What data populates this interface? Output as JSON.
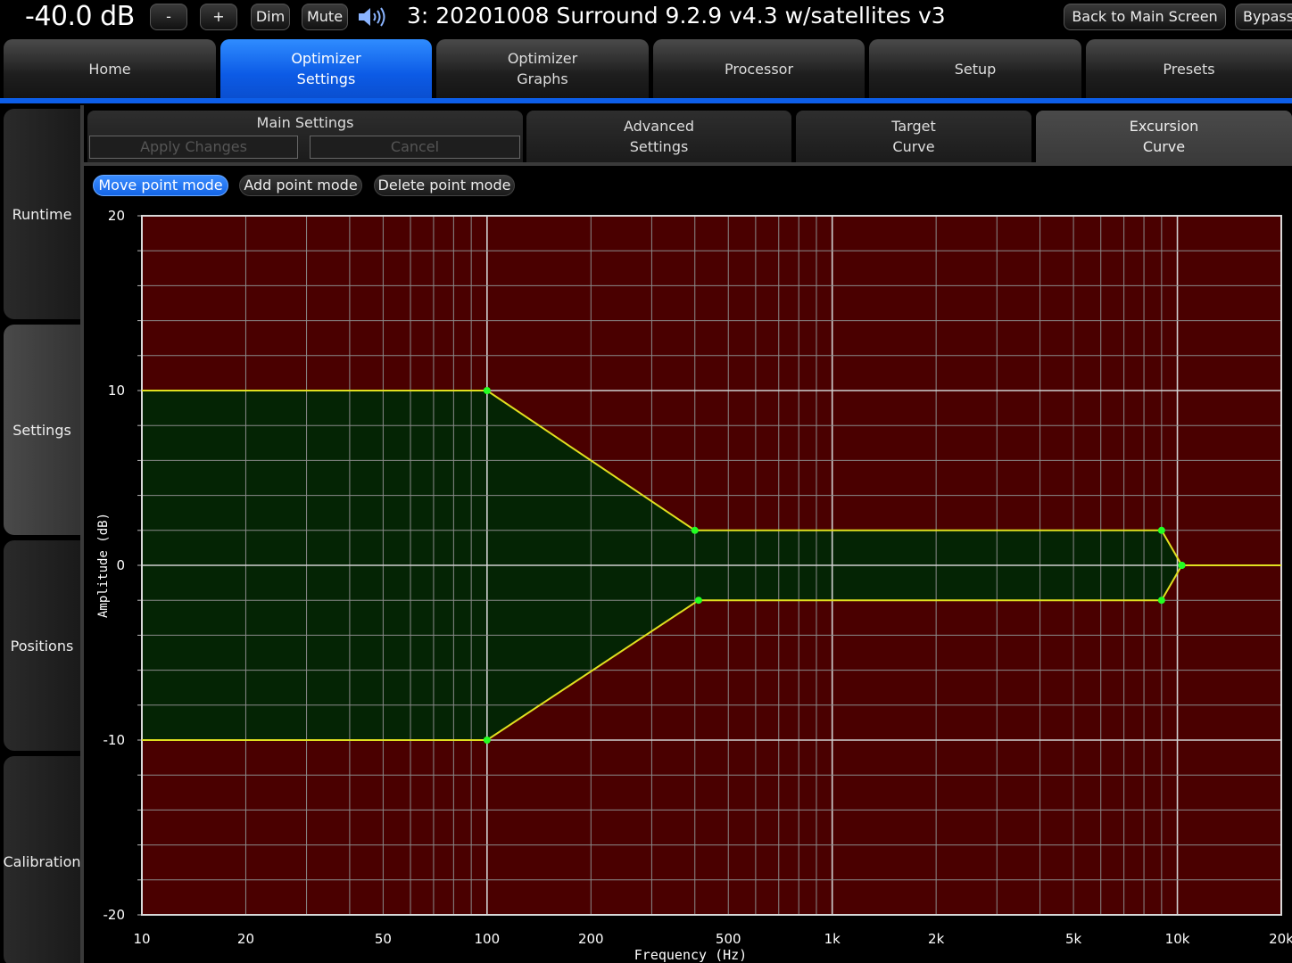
{
  "topbar": {
    "volume": "-40.0 dB",
    "minus_label": "-",
    "plus_label": "+",
    "dim_label": "Dim",
    "mute_label": "Mute",
    "preset_title": "3: 20201008 Surround 9.2.9 v4.3 w/satellites v3",
    "back_label": "Back to Main Screen",
    "bypass_label": "Bypass"
  },
  "main_tabs": [
    {
      "label": "Home"
    },
    {
      "label": "Optimizer\nSettings",
      "active": true
    },
    {
      "label": "Optimizer\nGraphs"
    },
    {
      "label": "Processor"
    },
    {
      "label": "Setup"
    },
    {
      "label": "Presets"
    }
  ],
  "side_tabs": [
    {
      "label": "Runtime"
    },
    {
      "label": "Settings",
      "active": true
    },
    {
      "label": "Positions"
    },
    {
      "label": "Calibration"
    }
  ],
  "sub_tabs": {
    "main_settings_label": "Main Settings",
    "apply_label": "Apply Changes",
    "cancel_label": "Cancel",
    "advanced_label": "Advanced\nSettings",
    "target_label": "Target\nCurve",
    "excursion_label": "Excursion\nCurve"
  },
  "modes": {
    "move_label": "Move point mode",
    "add_label": "Add point mode",
    "delete_label": "Delete point mode"
  },
  "colors": {
    "accent": "#0d5ee8",
    "plot_background": "#4a0000",
    "envelope_fill": "#042404",
    "curve": "#e0e020",
    "point": "#22ff22"
  },
  "chart_data": {
    "type": "area",
    "xlabel": "Frequency (Hz)",
    "ylabel": "Amplitude (dB)",
    "x_scale": "log",
    "xlim": [
      10,
      20000
    ],
    "ylim": [
      -20,
      20
    ],
    "grid": true,
    "x_ticks": [
      {
        "value": 10,
        "label": "10"
      },
      {
        "value": 20,
        "label": "20"
      },
      {
        "value": 50,
        "label": "50"
      },
      {
        "value": 100,
        "label": "100"
      },
      {
        "value": 200,
        "label": "200"
      },
      {
        "value": 500,
        "label": "500"
      },
      {
        "value": 1000,
        "label": "1k"
      },
      {
        "value": 2000,
        "label": "2k"
      },
      {
        "value": 5000,
        "label": "5k"
      },
      {
        "value": 10000,
        "label": "10k"
      },
      {
        "value": 20000,
        "label": "20k"
      }
    ],
    "y_ticks": [
      {
        "value": 20,
        "label": "20"
      },
      {
        "value": 10,
        "label": "10"
      },
      {
        "value": 0,
        "label": "0"
      },
      {
        "value": -10,
        "label": "-10"
      },
      {
        "value": -20,
        "label": "-20"
      }
    ],
    "series": [
      {
        "role": "upper",
        "x": [
          10,
          100,
          400,
          9000,
          10300,
          20000
        ],
        "y": [
          10,
          10,
          2,
          2,
          0,
          0
        ],
        "points": [
          [
            100,
            10
          ],
          [
            400,
            2
          ],
          [
            9000,
            2
          ],
          [
            10300,
            0
          ]
        ]
      },
      {
        "role": "lower",
        "x": [
          10,
          100,
          410,
          9000,
          10300,
          20000
        ],
        "y": [
          -10,
          -10,
          -2,
          -2,
          0,
          0
        ],
        "points": [
          [
            100,
            -10
          ],
          [
            410,
            -2
          ],
          [
            9000,
            -2
          ],
          [
            10300,
            0
          ]
        ]
      }
    ]
  }
}
